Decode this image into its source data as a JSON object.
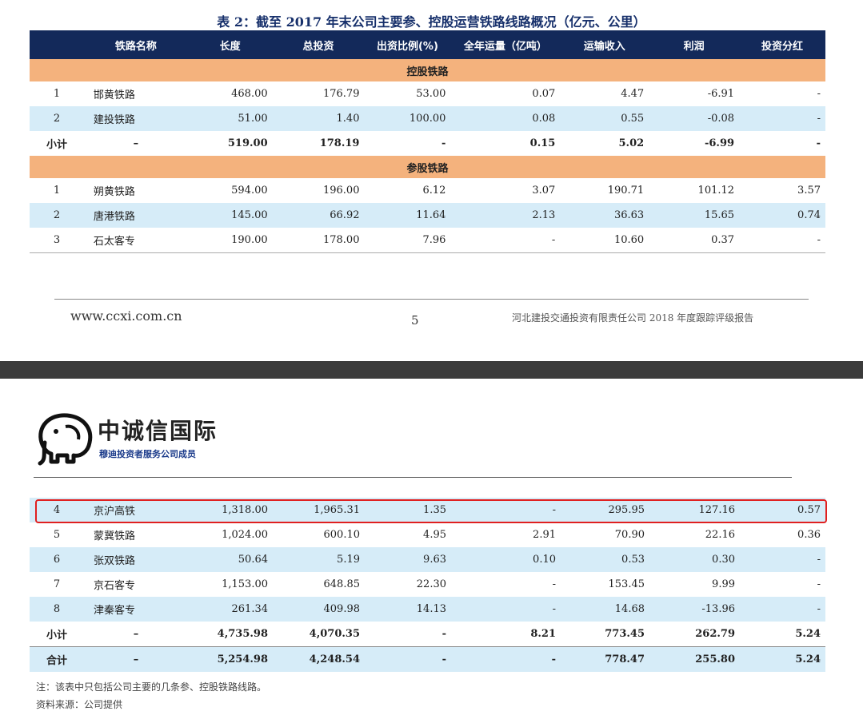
{
  "page1": {
    "title": "表 2：截至 2017 年末公司主要参、控股运营铁路线路概况（亿元、公里）",
    "headers": [
      "",
      "铁路名称",
      "长度",
      "总投资",
      "出资比例(%)",
      "全年运量（亿吨）",
      "运输收入",
      "利润",
      "投资分红"
    ],
    "section_control": "控股铁路",
    "control_rows": [
      [
        "1",
        "邯黄铁路",
        "468.00",
        "176.79",
        "53.00",
        "0.07",
        "4.47",
        "-6.91",
        "-"
      ],
      [
        "2",
        "建投铁路",
        "51.00",
        "1.40",
        "100.00",
        "0.08",
        "0.55",
        "-0.08",
        "-"
      ]
    ],
    "control_subtotal": [
      "小计",
      "–",
      "519.00",
      "178.19",
      "-",
      "0.15",
      "5.02",
      "-6.99",
      "-"
    ],
    "section_participate": "参股铁路",
    "participate_rows": [
      [
        "1",
        "朔黄铁路",
        "594.00",
        "196.00",
        "6.12",
        "3.07",
        "190.71",
        "101.12",
        "3.57"
      ],
      [
        "2",
        "唐港铁路",
        "145.00",
        "66.92",
        "11.64",
        "2.13",
        "36.63",
        "15.65",
        "0.74"
      ],
      [
        "3",
        "石太客专",
        "190.00",
        "178.00",
        "7.96",
        "-",
        "10.60",
        "0.37",
        "-"
      ]
    ],
    "footer": {
      "url": "www.ccxi.com.cn",
      "page": "5",
      "company": "河北建投交通投资有限责任公司 2018 年度跟踪评级报告"
    }
  },
  "page2": {
    "logo": {
      "name": "中诚信国际",
      "tagline": "穆迪投资者服务公司成员"
    },
    "rows": [
      [
        "4",
        "京沪高铁",
        "1,318.00",
        "1,965.31",
        "1.35",
        "-",
        "295.95",
        "127.16",
        "0.57"
      ],
      [
        "5",
        "蒙冀铁路",
        "1,024.00",
        "600.10",
        "4.95",
        "2.91",
        "70.90",
        "22.16",
        "0.36"
      ],
      [
        "6",
        "张双铁路",
        "50.64",
        "5.19",
        "9.63",
        "0.10",
        "0.53",
        "0.30",
        "-"
      ],
      [
        "7",
        "京石客专",
        "1,153.00",
        "648.85",
        "22.30",
        "-",
        "153.45",
        "9.99",
        "-"
      ],
      [
        "8",
        "津秦客专",
        "261.34",
        "409.98",
        "14.13",
        "-",
        "14.68",
        "-13.96",
        "-"
      ]
    ],
    "subtotal": [
      "小计",
      "–",
      "4,735.98",
      "4,070.35",
      "-",
      "8.21",
      "773.45",
      "262.79",
      "5.24"
    ],
    "total": [
      "合计",
      "–",
      "5,254.98",
      "4,248.54",
      "-",
      "-",
      "778.47",
      "255.80",
      "5.24"
    ],
    "note": "注：该表中只包括公司主要的几条参、控股铁路线路。",
    "source": "资料来源：公司提供"
  },
  "colors": {
    "header_bg": "#13295a",
    "section_bg": "#f4b27d",
    "row_blue": "#d6ecf8",
    "highlight": "#e02020"
  }
}
